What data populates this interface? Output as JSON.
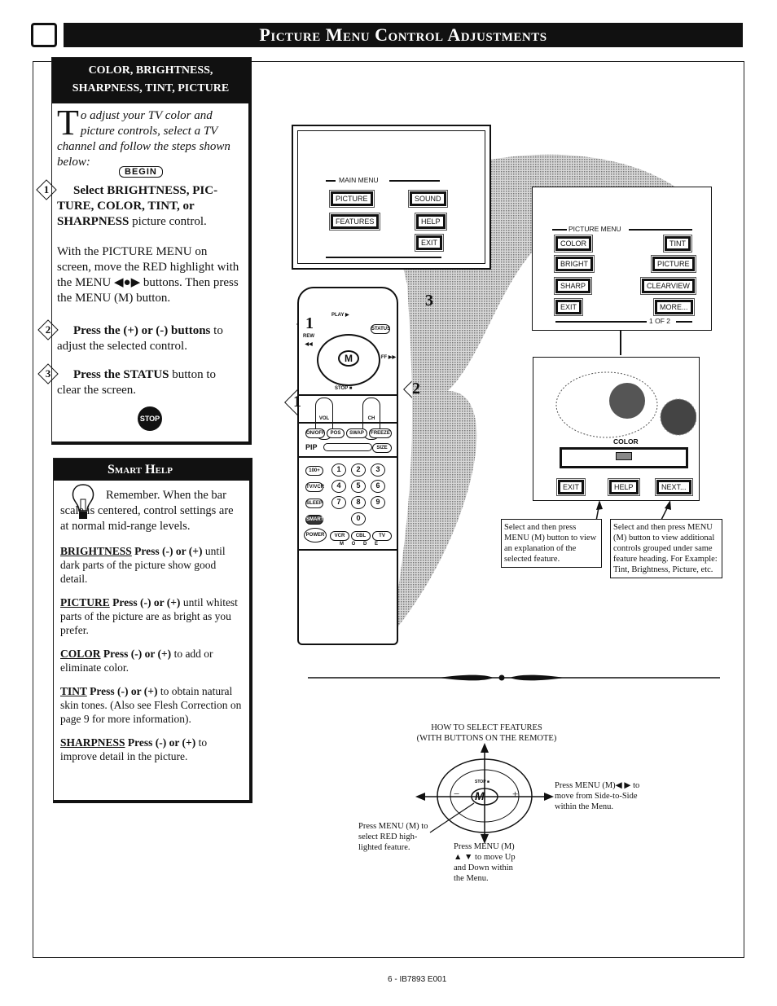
{
  "header": {
    "title": "Picture Menu Control Adjustments"
  },
  "steps_box": {
    "heading_line1": "COLOR, BRIGHTNESS,",
    "heading_line2": "SHARPNESS, TINT, PICTURE",
    "intro_dropcap": "T",
    "intro": "o adjust your TV color and picture controls, select a TV channel and follow the steps shown below:",
    "begin_label": "BEGIN",
    "steps": [
      {
        "number": "1",
        "bold": "Select BRIGHTNESS, PIC-TURE, COLOR, TINT, or SHARPNESS",
        "text": " picture control.",
        "extra": "With the PICTURE MENU on screen, move the RED highlight with the MENU ◀●▶ buttons. Then press the MENU (M) button."
      },
      {
        "number": "2",
        "bold": "Press the (+) or (-) buttons",
        "text": " to adjust the selected control."
      },
      {
        "number": "3",
        "bold": "Press the STATUS",
        "text": " button to clear the screen."
      }
    ],
    "stop_label": "STOP"
  },
  "smart_help": {
    "heading": "Smart Help",
    "intro": "Remember. When the bar scale is centered, control settings are at normal mid-range levels.",
    "items": [
      {
        "term": "BRIGHTNESS",
        "bold": " Press (-) or (+)",
        "text": " until dark parts of the picture show good detail."
      },
      {
        "term": "PICTURE",
        "bold": " Press (-) or (+)",
        "text": " until whitest parts of the picture are as bright as you prefer."
      },
      {
        "term": "COLOR",
        "bold": " Press (-) or (+)",
        "text": " to add or eliminate color."
      },
      {
        "term": "TINT",
        "bold": " Press (-) or (+)",
        "text": " to obtain natural skin tones.  (Also see Flesh Correction on page 9 for more information)."
      },
      {
        "term": "SHARPNESS",
        "bold": " Press (-) or (+)",
        "text": " to improve detail in the picture."
      }
    ]
  },
  "main_menu": {
    "title": "MAIN MENU",
    "buttons": [
      "PICTURE",
      "SOUND",
      "FEATURES",
      "HELP",
      "EXIT"
    ],
    "highlighted": "PICTURE"
  },
  "picture_menu": {
    "title": "PICTURE MENU",
    "buttons": [
      "COLOR",
      "TINT",
      "BRIGHT",
      "PICTURE",
      "SHARP",
      "CLEARVIEW",
      "EXIT",
      "MORE..."
    ],
    "highlighted": "COLOR",
    "page": "1 OF 2"
  },
  "color_screen": {
    "label": "COLOR",
    "level_percent": 50,
    "buttons": [
      "EXIT",
      "HELP",
      "NEXT..."
    ]
  },
  "callouts": {
    "help": "Select and then press MENU (M) button to view an explanation of the selected feature.",
    "next": "Select and then press MENU (M) button to view additional controls grouped under same feature heading. For Example: Tint, Brightness, Picture, etc."
  },
  "remote": {
    "keys": {
      "play": "PLAY ▶",
      "status": "STATUS",
      "rew": "REW ◀◀",
      "ff": "FF ▶▶",
      "stop": "STOP ■",
      "menu": "M",
      "vol": "VOL",
      "ch": "CH",
      "pip_row": [
        "ON/OFF",
        "POS",
        "SWAP",
        "FREEZE"
      ],
      "pip": "PIP",
      "size": "SIZE",
      "left": [
        "100+",
        "TV/VCR",
        "SLEEP",
        "SMART"
      ],
      "numbers": [
        "1",
        "2",
        "3",
        "4",
        "5",
        "6",
        "7",
        "8",
        "9",
        "0"
      ],
      "power": "POWER",
      "mode": [
        "VCR",
        "CBL",
        "TV"
      ],
      "mode_label": "M O D E"
    },
    "step_markers": [
      "1",
      "1",
      "2",
      "3"
    ]
  },
  "how_to": {
    "title_line1": "HOW TO SELECT FEATURES",
    "title_line2": "(WITH BUTTONS ON THE REMOTE)",
    "center": "M",
    "stop": "STOP ■",
    "minus": "−",
    "plus": "+",
    "select": "Press MENU (M) to select RED high-lighted feature.",
    "updown": "Press MENU (M) ▲ ▼ to move Up and Down within the Menu.",
    "side": "Press MENU (M)◀ ▶ to move from Side-to-Side within the Menu."
  },
  "footer": {
    "page": "6 - IB7893 E001"
  }
}
